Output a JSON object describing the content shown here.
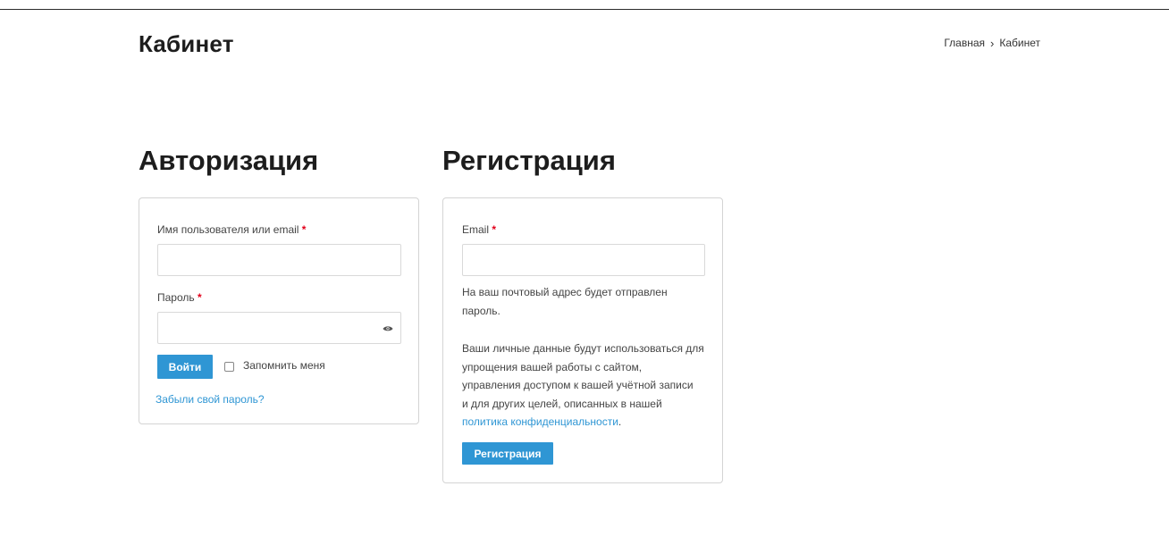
{
  "page": {
    "title": "Кабинет"
  },
  "breadcrumb": {
    "home": "Главная",
    "separator": "›",
    "current": "Кабинет"
  },
  "login": {
    "title": "Авторизация",
    "username_label": "Имя пользователя или email",
    "username_value": "",
    "password_label": "Пароль",
    "password_value": "",
    "required_mark": "*",
    "submit_label": "Войти",
    "remember_label": "Запомнить меня",
    "remember_checked": false,
    "forgot_link": "Забыли свой пароль?"
  },
  "register": {
    "title": "Регистрация",
    "email_label": "Email",
    "email_value": "",
    "required_mark": "*",
    "password_note_1": "На ваш почтовый адрес будет отправлен",
    "password_note_2": "пароль.",
    "privacy_line_1": "Ваши личные данные будут использоваться для",
    "privacy_line_2": "упрощения вашей работы с сайтом,",
    "privacy_line_3": "управления доступом к вашей учётной записи",
    "privacy_line_4": "и для других целей, описанных в нашей",
    "privacy_link": "политика конфиденциальности",
    "privacy_end": ".",
    "submit_label": "Регистрация"
  },
  "colors": {
    "accent": "#2f96d4",
    "required": "#e2001a",
    "border": "#d4d4d4"
  },
  "icons": {
    "password_toggle": "eye-icon",
    "breadcrumb_separator": "chevron-right-icon"
  }
}
